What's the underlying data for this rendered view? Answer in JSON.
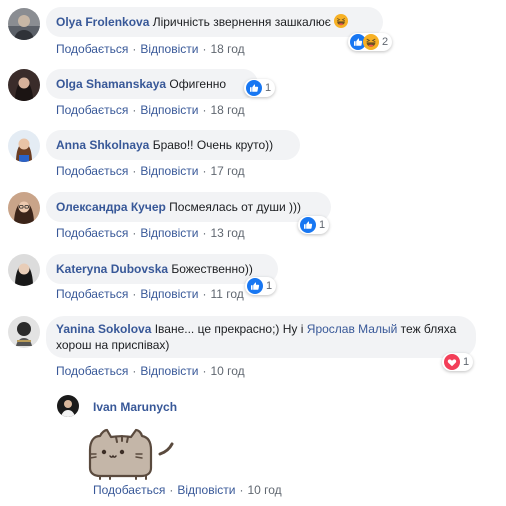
{
  "comments": [
    {
      "author": "Olya Frolenkova",
      "text": "Ліричність звернення зашкалює",
      "like": "Подобається",
      "reply": "Відповісти",
      "time": "18 год",
      "reaction_count": "2",
      "reactions": [
        "like-icon",
        "haha-icon"
      ]
    },
    {
      "author": "Olga Shamanskaya",
      "text": "Офигенно",
      "like": "Подобається",
      "reply": "Відповісти",
      "time": "18 год",
      "reaction_count": "1",
      "reactions": [
        "like-icon"
      ]
    },
    {
      "author": "Anna Shkolnaya",
      "text": "Браво!! Очень круто))",
      "like": "Подобається",
      "reply": "Відповісти",
      "time": "17 год"
    },
    {
      "author": "Олександра Кучер",
      "text": "Посмеялась от души )))",
      "like": "Подобається",
      "reply": "Відповісти",
      "time": "13 год",
      "reaction_count": "1",
      "reactions": [
        "like-icon"
      ]
    },
    {
      "author": "Kateryna Dubovska",
      "text": "Божественно))",
      "like": "Подобається",
      "reply": "Відповісти",
      "time": "11 год",
      "reaction_count": "1",
      "reactions": [
        "like-icon"
      ]
    },
    {
      "author": "Yanina Sokolova",
      "text_before": "Іване... це прекрасно;) Ну і",
      "mention": "Ярослав Малый",
      "text_after": "теж бляха хорош на приспівах)",
      "like": "Подобається",
      "reply": "Відповісти",
      "time": "10 год",
      "reaction_count": "1",
      "reactions": [
        "love-icon"
      ]
    }
  ],
  "reply": {
    "author": "Ivan Marunych",
    "sticker": "pusheen-cat-sticker",
    "like": "Подобається",
    "reply": "Відповісти",
    "time": "10 год"
  },
  "colors": {
    "link": "#385898",
    "bubble": "#f2f3f5",
    "meta": "#606770",
    "like_blue": "#1877f2",
    "love_red": "#f33e58",
    "haha_yellow": "#f7b125"
  }
}
